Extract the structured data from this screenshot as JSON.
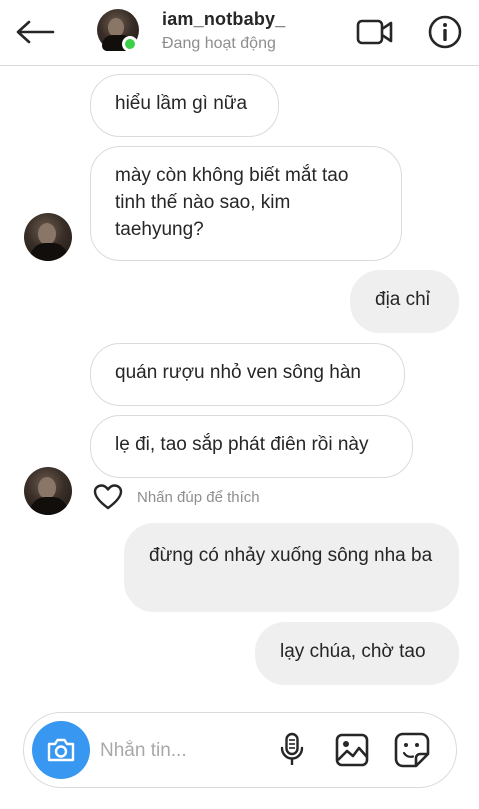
{
  "header": {
    "username": "iam_notbaby_",
    "status": "Đang hoạt động",
    "icons": {
      "back": "back-arrow-icon",
      "video": "video-camera-icon",
      "info": "info-icon"
    },
    "online_color": "#3cd04a"
  },
  "messages": [
    {
      "sender": "them",
      "text": "hiểu lầm gì nữa"
    },
    {
      "sender": "them",
      "text": "mày còn không biết mắt tao tinh thế nào sao, kim taehyung?"
    },
    {
      "sender": "me",
      "text": "địa chỉ"
    },
    {
      "sender": "them",
      "text": "quán rượu nhỏ ven sông hàn"
    },
    {
      "sender": "them",
      "text": "lẹ đi, tao sắp phát điên rồi này"
    },
    {
      "sender": "me",
      "text": "đừng có nhảy xuống sông nha ba"
    },
    {
      "sender": "me",
      "text": "lạy chúa, chờ tao"
    }
  ],
  "like_hint": "Nhấn đúp để thích",
  "composer": {
    "placeholder": "Nhắn tin...",
    "accent": "#3897f0",
    "icons": [
      "camera-icon",
      "microphone-icon",
      "gallery-icon",
      "sticker-icon"
    ]
  }
}
